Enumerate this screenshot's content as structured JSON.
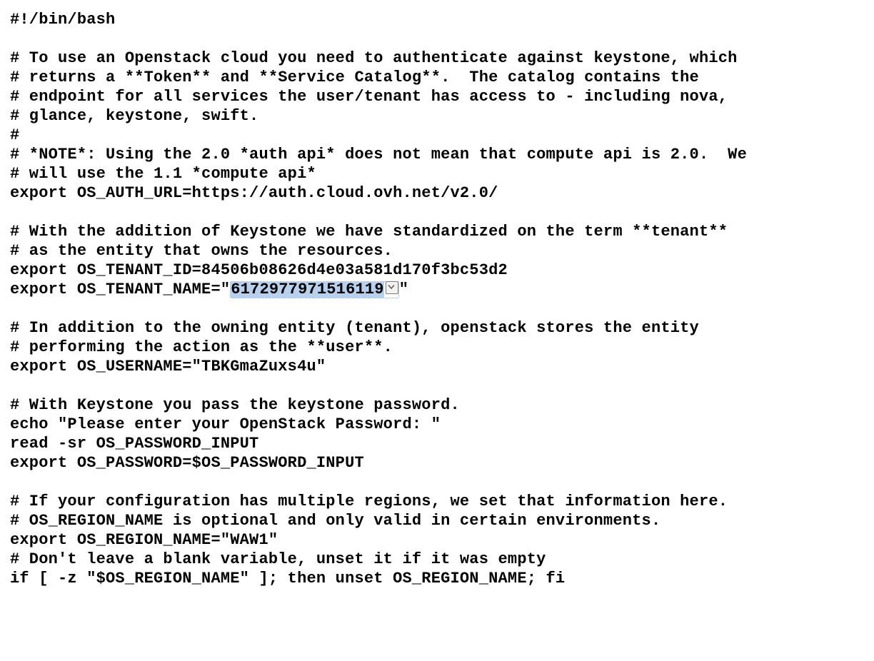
{
  "lines": {
    "l1": "#!/bin/bash",
    "l2": "",
    "l3": "# To use an Openstack cloud you need to authenticate against keystone, which",
    "l4": "# returns a **Token** and **Service Catalog**.  The catalog contains the",
    "l5": "# endpoint for all services the user/tenant has access to - including nova,",
    "l6": "# glance, keystone, swift.",
    "l7": "#",
    "l8": "# *NOTE*: Using the 2.0 *auth api* does not mean that compute api is 2.0.  We",
    "l9": "# will use the 1.1 *compute api*",
    "l10": "export OS_AUTH_URL=https://auth.cloud.ovh.net/v2.0/",
    "l11": "",
    "l12": "# With the addition of Keystone we have standardized on the term **tenant**",
    "l13": "# as the entity that owns the resources.",
    "l14": "export OS_TENANT_ID=84506b08626d4e03a581d170f3bc53d2",
    "l15a": "export OS_TENANT_NAME=\"",
    "l15sel": "6172977971516119",
    "l15b": "\"",
    "l16": "",
    "l17": "# In addition to the owning entity (tenant), openstack stores the entity",
    "l18": "# performing the action as the **user**.",
    "l19": "export OS_USERNAME=\"TBKGmaZuxs4u\"",
    "l20": "",
    "l21": "# With Keystone you pass the keystone password.",
    "l22": "echo \"Please enter your OpenStack Password: \"",
    "l23": "read -sr OS_PASSWORD_INPUT",
    "l24": "export OS_PASSWORD=$OS_PASSWORD_INPUT",
    "l25": "",
    "l26": "# If your configuration has multiple regions, we set that information here.",
    "l27": "# OS_REGION_NAME is optional and only valid in certain environments.",
    "l28": "export OS_REGION_NAME=\"WAW1\"",
    "l29": "# Don't leave a blank variable, unset it if it was empty",
    "l30": "if [ -z \"$OS_REGION_NAME\" ]; then unset OS_REGION_NAME; fi"
  }
}
